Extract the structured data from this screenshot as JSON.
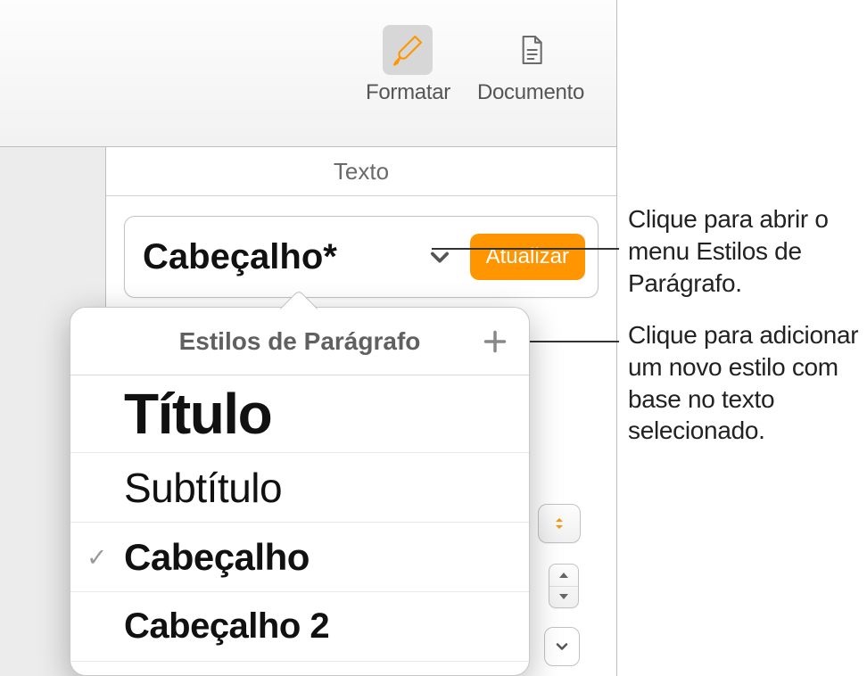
{
  "toolbar": {
    "format_label": "Formatar",
    "document_label": "Documento"
  },
  "inspector": {
    "header_label": "Texto",
    "style_picker": {
      "current_style": "Cabeçalho*",
      "update_label": "Atualizar"
    }
  },
  "popover": {
    "title": "Estilos de Parágrafo",
    "items": [
      {
        "label": "Título",
        "css_class": "style-title",
        "checked": false
      },
      {
        "label": "Subtítulo",
        "css_class": "style-subtitle",
        "checked": false
      },
      {
        "label": "Cabeçalho",
        "css_class": "style-heading",
        "checked": true
      },
      {
        "label": "Cabeçalho 2",
        "css_class": "style-heading2",
        "checked": false
      }
    ]
  },
  "callouts": {
    "open_menu": "Clique para abrir o menu Estilos de Parágrafo.",
    "add_style": "Clique para adicionar um novo estilo com base no texto selecionado."
  },
  "colors": {
    "accent": "#ff9500"
  }
}
